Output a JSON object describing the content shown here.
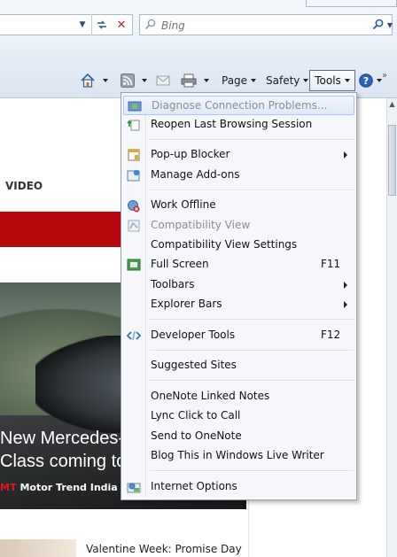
{
  "search": {
    "placeholder": "Bing"
  },
  "toolbar": {
    "page_label": "Page",
    "safety_label": "Safety",
    "tools_label": "Tools",
    "help_icon": "help-icon"
  },
  "content": {
    "section_label": "VIDEO",
    "hero_title": "New Mercedes-\nClass coming to",
    "hero_source_mark": "MT",
    "hero_source": "Motor Trend India",
    "story2_title": "Valentine Week: Promise Day"
  },
  "menu": {
    "items": [
      {
        "label": "Diagnose Connection Problems...",
        "icon": "diagnose-icon",
        "state": "highlighted-disabled"
      },
      {
        "label": "Reopen Last Browsing Session",
        "icon": "reopen-session-icon"
      },
      {
        "label": "Pop-up Blocker",
        "icon": "popup-blocker-icon",
        "submenu": true
      },
      {
        "label": "Manage Add-ons",
        "icon": "addons-icon"
      },
      {
        "label": "Work Offline",
        "icon": "work-offline-icon"
      },
      {
        "label": "Compatibility View",
        "icon": "compat-view-icon",
        "disabled": true
      },
      {
        "label": "Compatibility View Settings"
      },
      {
        "label": "Full Screen",
        "icon": "fullscreen-icon",
        "shortcut": "F11"
      },
      {
        "label": "Toolbars",
        "submenu": true
      },
      {
        "label": "Explorer Bars",
        "submenu": true
      },
      {
        "label": "Developer Tools",
        "icon": "developer-tools-icon",
        "shortcut": "F12"
      },
      {
        "label": "Suggested Sites"
      },
      {
        "label": "OneNote Linked Notes"
      },
      {
        "label": "Lync Click to Call"
      },
      {
        "label": "Send to OneNote"
      },
      {
        "label": "Blog This in Windows Live Writer"
      },
      {
        "label": "Internet Options",
        "icon": "internet-options-icon"
      }
    ]
  },
  "colors": {
    "accent_red": "#b7080d",
    "menu_highlight_border": "#aec8eb"
  }
}
